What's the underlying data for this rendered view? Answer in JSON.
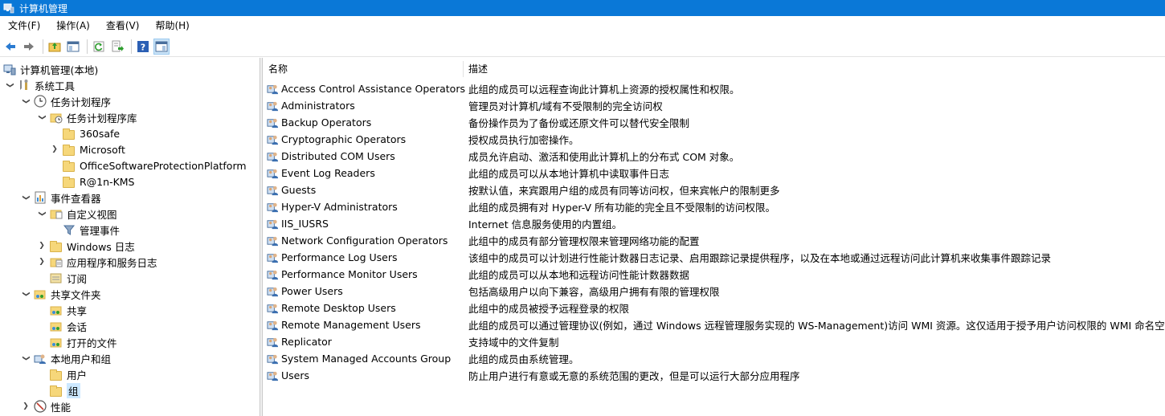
{
  "window": {
    "title": "计算机管理",
    "accent": "#0a78d7"
  },
  "menu": [
    "文件(F)",
    "操作(A)",
    "查看(V)",
    "帮助(H)"
  ],
  "toolbar": {
    "icons": [
      "back-icon",
      "forward-icon",
      "up-folder-icon",
      "show-hide-tree-icon",
      "refresh-icon",
      "export-list-icon",
      "help-icon",
      "properties-pane-icon"
    ]
  },
  "tree": {
    "root": "计算机管理(本地)",
    "system_tools": "系统工具",
    "task_scheduler": "任务计划程序",
    "task_library": "任务计划程序库",
    "lib_360safe": "360safe",
    "lib_microsoft": "Microsoft",
    "lib_office": "OfficeSoftwareProtectionPlatform",
    "lib_r1n": "R@1n-KMS",
    "event_viewer": "事件查看器",
    "custom_views": "自定义视图",
    "admin_events": "管理事件",
    "windows_logs": "Windows 日志",
    "app_service_logs": "应用程序和服务日志",
    "subscriptions": "订阅",
    "shared_folders": "共享文件夹",
    "shares": "共享",
    "sessions": "会话",
    "open_files": "打开的文件",
    "local_users_groups": "本地用户和组",
    "users": "用户",
    "groups": "组",
    "performance": "性能"
  },
  "list": {
    "columns": {
      "name": "名称",
      "description": "描述"
    },
    "rows": [
      {
        "name": "Access Control Assistance Operators",
        "description": "此组的成员可以远程查询此计算机上资源的授权属性和权限。"
      },
      {
        "name": "Administrators",
        "description": "管理员对计算机/域有不受限制的完全访问权"
      },
      {
        "name": "Backup Operators",
        "description": "备份操作员为了备份或还原文件可以替代安全限制"
      },
      {
        "name": "Cryptographic Operators",
        "description": "授权成员执行加密操作。"
      },
      {
        "name": "Distributed COM Users",
        "description": "成员允许启动、激活和使用此计算机上的分布式 COM 对象。"
      },
      {
        "name": "Event Log Readers",
        "description": "此组的成员可以从本地计算机中读取事件日志"
      },
      {
        "name": "Guests",
        "description": "按默认值，来宾跟用户组的成员有同等访问权，但来宾帐户的限制更多"
      },
      {
        "name": "Hyper-V Administrators",
        "description": "此组的成员拥有对 Hyper-V 所有功能的完全且不受限制的访问权限。"
      },
      {
        "name": "IIS_IUSRS",
        "description": "Internet 信息服务使用的内置组。"
      },
      {
        "name": "Network Configuration Operators",
        "description": "此组中的成员有部分管理权限来管理网络功能的配置"
      },
      {
        "name": "Performance Log Users",
        "description": "该组中的成员可以计划进行性能计数器日志记录、启用跟踪记录提供程序，以及在本地或通过远程访问此计算机来收集事件跟踪记录"
      },
      {
        "name": "Performance Monitor Users",
        "description": "此组的成员可以从本地和远程访问性能计数器数据"
      },
      {
        "name": "Power Users",
        "description": "包括高级用户以向下兼容，高级用户拥有有限的管理权限"
      },
      {
        "name": "Remote Desktop Users",
        "description": "此组中的成员被授予远程登录的权限"
      },
      {
        "name": "Remote Management Users",
        "description": "此组的成员可以通过管理协议(例如，通过 Windows 远程管理服务实现的 WS-Management)访问 WMI 资源。这仅适用于授予用户访问权限的 WMI 命名空间。"
      },
      {
        "name": "Replicator",
        "description": "支持域中的文件复制"
      },
      {
        "name": "System Managed Accounts Group",
        "description": "此组的成员由系统管理。"
      },
      {
        "name": "Users",
        "description": "防止用户进行有意或无意的系统范围的更改，但是可以运行大部分应用程序"
      }
    ]
  }
}
